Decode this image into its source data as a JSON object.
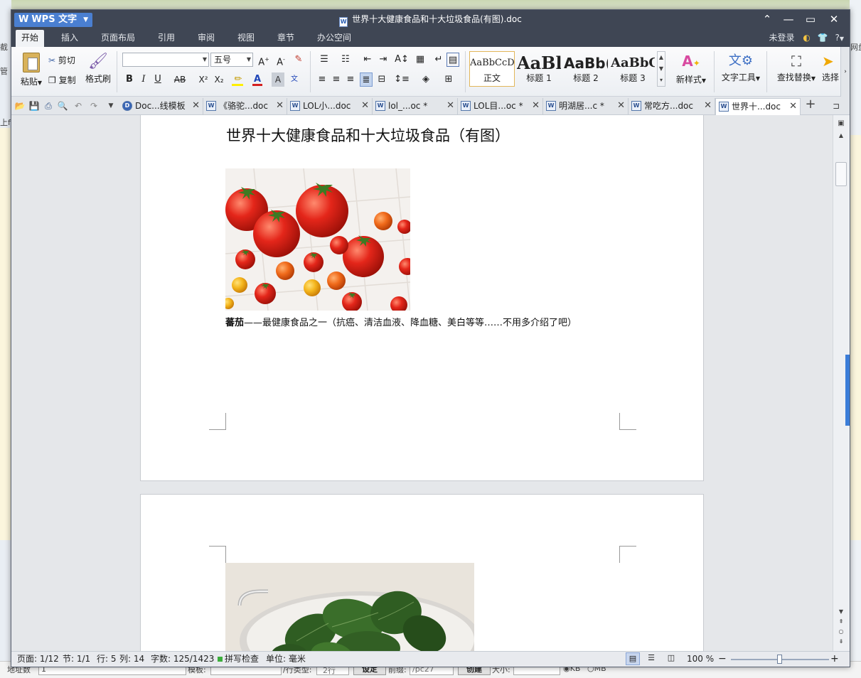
{
  "background": {
    "left_fragments": [
      "截",
      "管",
      "上f"
    ],
    "right_fragments": [
      "网盘"
    ],
    "bottom_bar": {
      "address_label": "地址数",
      "address_value": "1",
      "mode_label": "模板:",
      "type_label": "/行类型:",
      "type_value": "2行",
      "set_button": "设定",
      "prefix_label": "前缀:",
      "prefix_value": "/pc27",
      "create_button": "创建",
      "size_label": "大小:",
      "unit_kb": "KB",
      "unit_mb": "MB"
    }
  },
  "titlebar": {
    "app_name": "WPS 文字",
    "doc_title": "世界十大健康食品和十大垃圾食品(有图).doc"
  },
  "menu": {
    "items": [
      "开始",
      "插入",
      "页面布局",
      "引用",
      "审阅",
      "视图",
      "章节",
      "办公空间"
    ],
    "active": "开始",
    "user_status": "未登录",
    "help": "?"
  },
  "ribbon": {
    "paste": "粘贴",
    "cut": "剪切",
    "copy": "复制",
    "format_painter": "格式刷",
    "font_name": "",
    "font_size": "五号",
    "bold": "B",
    "italic": "I",
    "underline": "U",
    "strike": "AB",
    "superscript": "X²",
    "subscript": "X₂",
    "styles": [
      {
        "sample": "AaBbCcDd",
        "name": "正文"
      },
      {
        "sample": "AaBl",
        "name": "标题 1"
      },
      {
        "sample": "AaBb(",
        "name": "标题 2"
      },
      {
        "sample": "AaBbC",
        "name": "标题 3"
      }
    ],
    "new_style": "新样式",
    "text_tools": "文字工具",
    "find_replace": "查找替换",
    "select": "选择"
  },
  "tabs": [
    {
      "label": "Doc...线模板",
      "active": false
    },
    {
      "label": "《骆驼...doc",
      "active": false
    },
    {
      "label": "LOL小...doc",
      "active": false
    },
    {
      "label": "lol_...oc *",
      "active": false
    },
    {
      "label": "LOL目...oc *",
      "active": false
    },
    {
      "label": "明湖居...c *",
      "active": false
    },
    {
      "label": "常吃方...doc",
      "active": false
    },
    {
      "label": "世界十...doc",
      "active": true
    }
  ],
  "document": {
    "heading": "世界十大健康食品和十大垃圾食品（有图）",
    "caption_bold": "蕃茄",
    "caption_rest": "——最健康食品之一（抗癌、清洁血液、降血糖、美白等等……不用多介绍了吧）"
  },
  "status": {
    "page": "页面: 1/12",
    "section": "节: 1/1",
    "line": "行: 5",
    "column": "列: 14",
    "word_count": "字数: 125/1423",
    "spell_check": "拼写检查",
    "unit": "单位: 毫米",
    "zoom": "100 %",
    "zoom_level_fraction": 0.5
  },
  "colors": {
    "title_bg": "#3f4654",
    "accent": "#4a7fd1",
    "page_bg": "#ffffff",
    "workspace_bg": "#e5e7ea"
  }
}
